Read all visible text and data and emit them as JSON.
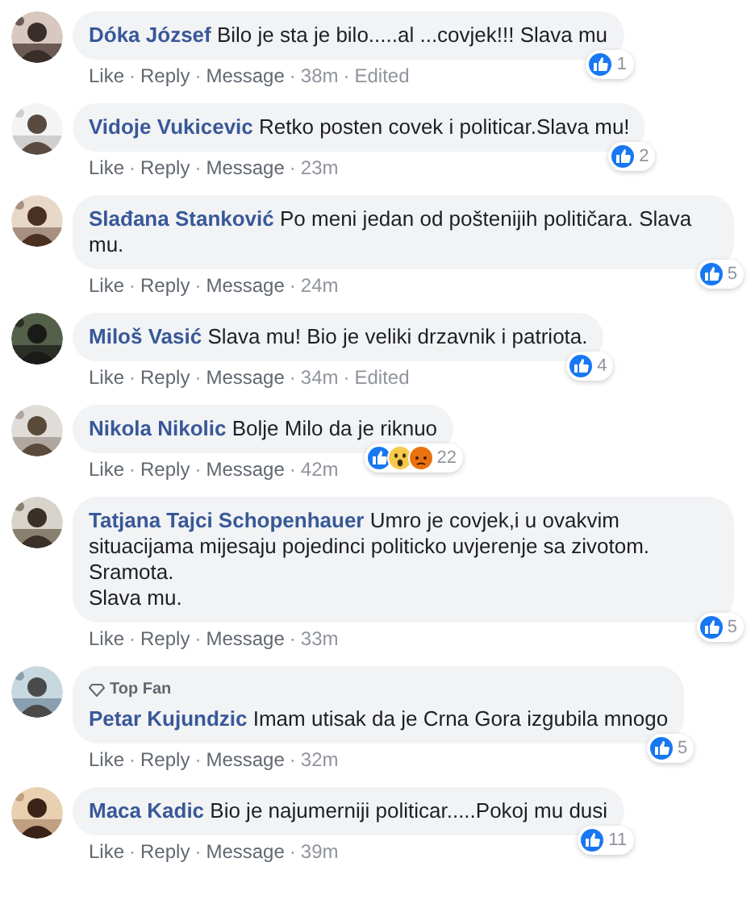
{
  "comments": [
    {
      "author": "Dóka József",
      "text": "Bilo je sta je bilo.....al ...covjek!!! Slava mu",
      "top_fan": false,
      "reactions": [
        {
          "kind": "like"
        }
      ],
      "reaction_count": "1",
      "actions": [
        "Like",
        "Reply",
        "Message"
      ],
      "separators": [
        "·",
        "·",
        "·",
        "·"
      ],
      "time": "38m",
      "edited": "Edited"
    },
    {
      "author": "Vidoje Vukicevic",
      "text": "Retko posten covek i politicar.Slava mu!",
      "top_fan": false,
      "reactions": [
        {
          "kind": "like"
        }
      ],
      "reaction_count": "2",
      "actions": [
        "Like",
        "Reply",
        "Message"
      ],
      "separators": [
        "·",
        "·",
        "·"
      ],
      "time": "23m"
    },
    {
      "author": "Slađana Stanković",
      "text": "Po meni jedan od poštenijih političara. Slava mu.",
      "top_fan": false,
      "reactions": [
        {
          "kind": "like"
        }
      ],
      "reaction_count": "5",
      "actions": [
        "Like",
        "Reply",
        "Message"
      ],
      "separators": [
        "·",
        "·",
        "·"
      ],
      "time": "24m"
    },
    {
      "author": "Miloš Vasić",
      "text": "Slava mu! Bio je veliki drzavnik i patriota.",
      "top_fan": false,
      "reactions": [
        {
          "kind": "like"
        }
      ],
      "reaction_count": "4",
      "actions": [
        "Like",
        "Reply",
        "Message"
      ],
      "separators": [
        "·",
        "·",
        "·",
        "·"
      ],
      "time": "34m",
      "edited": "Edited"
    },
    {
      "author": "Nikola Nikolic",
      "text": "Bolje Milo da je riknuo",
      "top_fan": false,
      "reactions": [
        {
          "kind": "like"
        },
        {
          "kind": "wow"
        },
        {
          "kind": "angry"
        }
      ],
      "reaction_count": "22",
      "actions": [
        "Like",
        "Reply",
        "Message"
      ],
      "separators": [
        "·",
        "·",
        "·"
      ],
      "time": "42m"
    },
    {
      "author": "Tatjana Tajci Schopenhauer",
      "text": "Umro je covjek,i u ovakvim situacijama mijesaju pojedinci politicko uvjerenje sa zivotom.\nSramota.\nSlava mu.",
      "top_fan": false,
      "reactions": [
        {
          "kind": "like"
        }
      ],
      "reaction_count": "5",
      "actions": [
        "Like",
        "Reply",
        "Message"
      ],
      "separators": [
        "·",
        "·",
        "·"
      ],
      "time": "33m"
    },
    {
      "author": "Petar Kujundzic",
      "text": "Imam utisak da je Crna Gora izgubila mnogo",
      "top_fan": true,
      "top_fan_label": "Top Fan",
      "reactions": [
        {
          "kind": "like"
        }
      ],
      "reaction_count": "5",
      "actions": [
        "Like",
        "Reply",
        "Message"
      ],
      "separators": [
        "·",
        "·",
        "·"
      ],
      "time": "32m"
    },
    {
      "author": "Maca Kadic",
      "text": "Bio je najumerniji politicar.....Pokoj mu dusi",
      "top_fan": false,
      "reactions": [
        {
          "kind": "like"
        }
      ],
      "reaction_count": "11",
      "actions": [
        "Like",
        "Reply",
        "Message"
      ],
      "separators": [
        "·",
        "·",
        "·"
      ],
      "time": "39m"
    }
  ]
}
